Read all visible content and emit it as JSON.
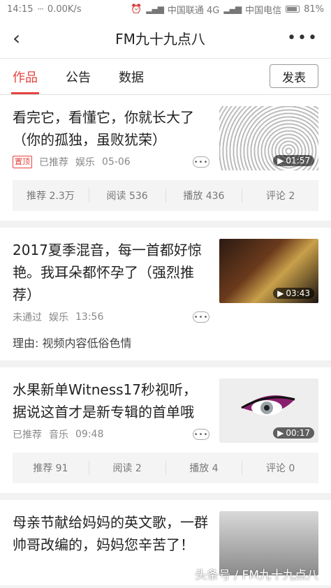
{
  "status": {
    "time": "14:15",
    "speed": "0.00K/s",
    "carrier1": "中国联通 4G",
    "carrier2": "中国电信",
    "battery": "81%"
  },
  "nav": {
    "title": "FM九十九点八"
  },
  "tabs": [
    {
      "label": "作品",
      "active": true
    },
    {
      "label": "公告"
    },
    {
      "label": "数据"
    }
  ],
  "publish_label": "发表",
  "cards": [
    {
      "title": "看完它，看懂它，你就长大了（你的孤独，虽败犹荣）",
      "pin": "置顶",
      "status": "已推荐",
      "category": "娱乐",
      "date": "05-06",
      "duration": "01:57",
      "stats": [
        "推荐 2.3万",
        "阅读 536",
        "播放 436",
        "评论 2"
      ]
    },
    {
      "title": "2017夏季混音，每一首都好惊艳。我耳朵都怀孕了（强烈推荐）",
      "status": "未通过",
      "category": "娱乐",
      "date": "13:56",
      "duration": "03:43",
      "reason": "理由: 视频内容低俗色情"
    },
    {
      "title": "水果新单Witness17秒视听，据说这首才是新专辑的首单哦",
      "status": "已推荐",
      "category": "音乐",
      "date": "09:48",
      "duration": "00:17",
      "stats": [
        "推荐 91",
        "阅读 2",
        "播放 4",
        "评论 0"
      ]
    },
    {
      "title": "母亲节献给妈妈的英文歌，一群帅哥改编的，妈妈您辛苦了！"
    }
  ],
  "watermark": "头条号 / FM九十九点八"
}
